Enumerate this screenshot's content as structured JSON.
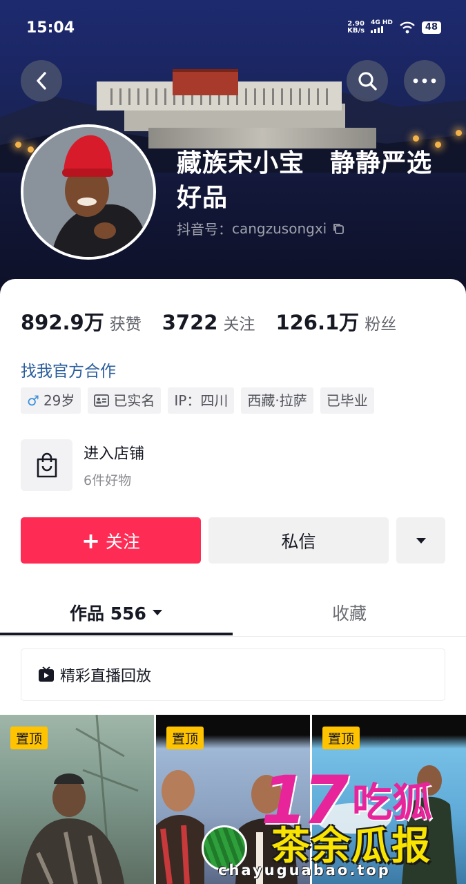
{
  "status_bar": {
    "time": "15:04",
    "speed_value": "2.90",
    "speed_unit": "KB/s",
    "network": "4G HD",
    "battery": "48"
  },
  "profile": {
    "name": "藏族宋小宝　静静严选好品",
    "id_label": "抖音号：",
    "id_value": "cangzusongxi"
  },
  "stats": [
    {
      "value": "892.9万",
      "label": "获赞"
    },
    {
      "value": "3722",
      "label": "关注"
    },
    {
      "value": "126.1万",
      "label": "粉丝"
    }
  ],
  "official_link": "找我官方合作",
  "tags": {
    "age": "29岁",
    "verified": "已实名",
    "ip": "IP：四川",
    "location": "西藏·拉萨",
    "education": "已毕业"
  },
  "shop": {
    "title": "进入店铺",
    "subtitle": "6件好物"
  },
  "actions": {
    "follow": "关注",
    "message": "私信"
  },
  "tabs": {
    "works": "作品 556",
    "collect": "收藏"
  },
  "replay_label": "精彩直播回放",
  "pinned_label": "置顶",
  "watermark": {
    "big": "17",
    "small": "吃狐",
    "main": "茶余瓜报",
    "url": "chayuguabao.top"
  },
  "colors": {
    "accent": "#fe2c55",
    "link": "#2a5d9c",
    "pin": "#ffc300"
  }
}
